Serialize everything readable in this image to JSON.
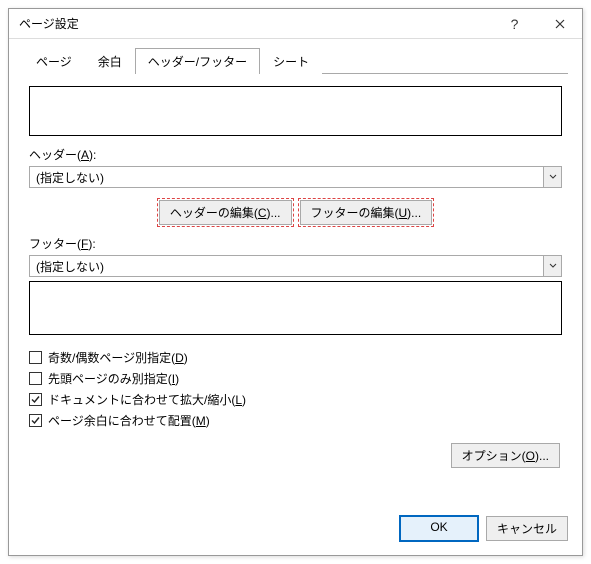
{
  "titlebar": {
    "title": "ページ設定"
  },
  "tabs": [
    {
      "label": "ページ",
      "active": false
    },
    {
      "label": "余白",
      "active": false
    },
    {
      "label": "ヘッダー/フッター",
      "active": true
    },
    {
      "label": "シート",
      "active": false
    }
  ],
  "header": {
    "label_prefix": "ヘッダー(",
    "label_key": "A",
    "label_suffix": "):",
    "value": "(指定しない)"
  },
  "footer": {
    "label_prefix": "フッター(",
    "label_key": "F",
    "label_suffix": "):",
    "value": "(指定しない)"
  },
  "buttons": {
    "edit_header_prefix": "ヘッダーの編集(",
    "edit_header_key": "C",
    "edit_header_suffix": ")...",
    "edit_footer_prefix": "フッターの編集(",
    "edit_footer_key": "U",
    "edit_footer_suffix": ")...",
    "options_prefix": "オプション(",
    "options_key": "O",
    "options_suffix": ")...",
    "ok": "OK",
    "cancel": "キャンセル"
  },
  "checks": [
    {
      "prefix": "奇数/偶数ページ別指定(",
      "key": "D",
      "suffix": ")",
      "checked": false
    },
    {
      "prefix": "先頭ページのみ別指定(",
      "key": "I",
      "suffix": ")",
      "checked": false
    },
    {
      "prefix": "ドキュメントに合わせて拡大/縮小(",
      "key": "L",
      "suffix": ")",
      "checked": true
    },
    {
      "prefix": "ページ余白に合わせて配置(",
      "key": "M",
      "suffix": ")",
      "checked": true
    }
  ]
}
